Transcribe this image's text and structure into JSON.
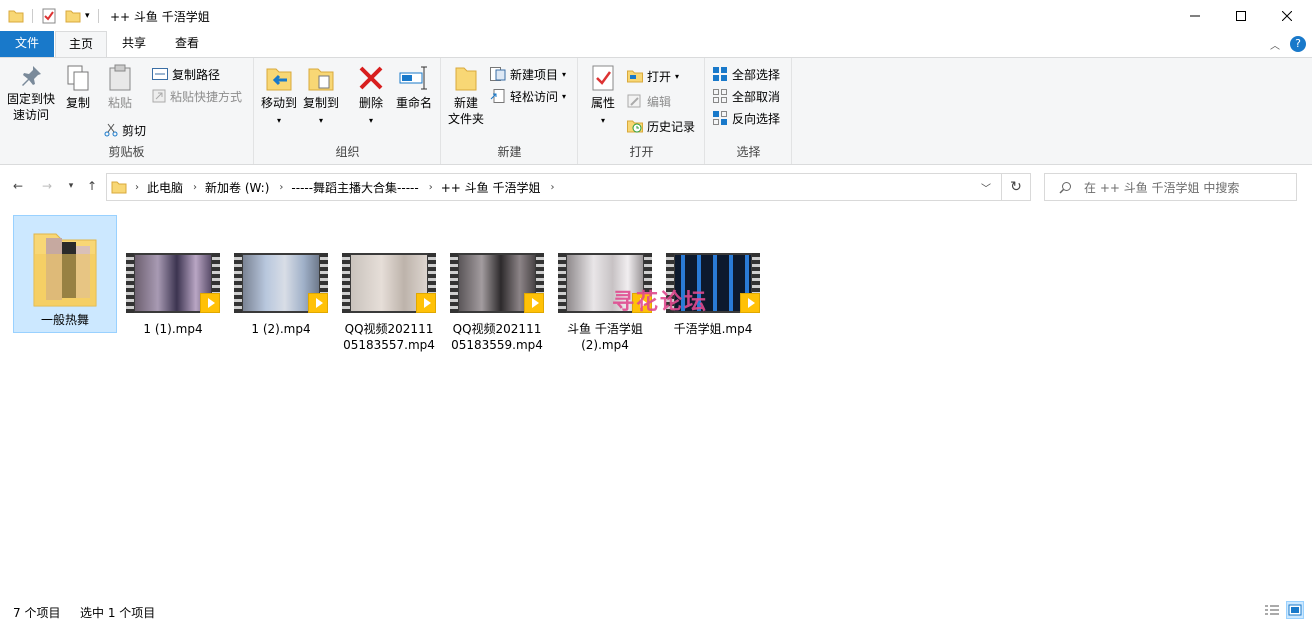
{
  "window": {
    "title": "++ 斗鱼 千浯学姐"
  },
  "tabs": {
    "file": "文件",
    "home": "主页",
    "share": "共享",
    "view": "查看"
  },
  "ribbon": {
    "clipboard": {
      "label": "剪贴板",
      "pin": "固定到快\n速访问",
      "pin_l1": "固定到快",
      "pin_l2": "速访问",
      "copy": "复制",
      "paste": "粘贴",
      "copy_path": "复制路径",
      "paste_shortcut": "粘贴快捷方式",
      "cut": "剪切"
    },
    "organize": {
      "label": "组织",
      "move_to": "移动到",
      "copy_to": "复制到",
      "delete": "删除",
      "rename": "重命名"
    },
    "new": {
      "label": "新建",
      "new_folder_l1": "新建",
      "new_folder_l2": "文件夹",
      "new_item": "新建项目",
      "easy_access": "轻松访问"
    },
    "open": {
      "label": "打开",
      "properties": "属性",
      "open": "打开",
      "edit": "编辑",
      "history": "历史记录"
    },
    "select": {
      "label": "选择",
      "select_all": "全部选择",
      "select_none": "全部取消",
      "invert": "反向选择"
    }
  },
  "breadcrumbs": [
    "此电脑",
    "新加卷 (W:)",
    "-----舞蹈主播大合集-----",
    "++ 斗鱼 千浯学姐"
  ],
  "search": {
    "placeholder": "在 ++ 斗鱼 千浯学姐 中搜索"
  },
  "files": [
    {
      "name": "一般热舞",
      "type": "folder"
    },
    {
      "name": "1 (1).mp4",
      "type": "video"
    },
    {
      "name": "1 (2).mp4",
      "type": "video"
    },
    {
      "name": "QQ视频20211105183557.mp4",
      "type": "video"
    },
    {
      "name": "QQ视频20211105183559.mp4",
      "type": "video"
    },
    {
      "name": "斗鱼 千浯学姐 (2).mp4",
      "type": "video"
    },
    {
      "name": "千浯学姐.mp4",
      "type": "video"
    }
  ],
  "watermark": "寻花论坛",
  "status": {
    "count": "7 个项目",
    "selected": "选中 1 个项目"
  },
  "colors": {
    "accent": "#1979ca",
    "selection": "#cce8ff",
    "player_badge": "#ffc107"
  }
}
